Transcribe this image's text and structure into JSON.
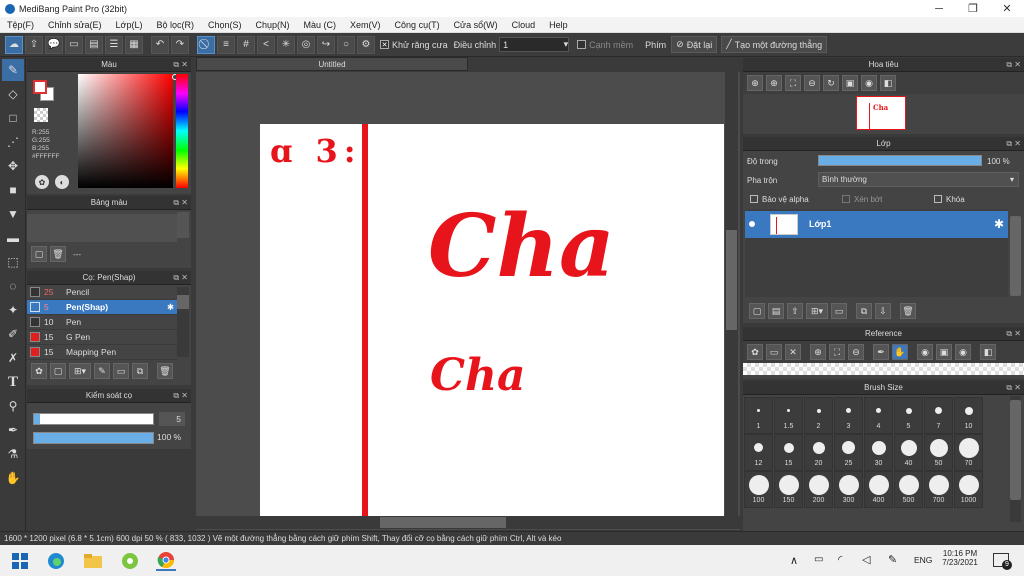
{
  "window": {
    "title": "MediBang Paint Pro (32bit)",
    "minimize": "─",
    "maximize": "❐",
    "close": "✕"
  },
  "menu": [
    "Tệp(F)",
    "Chỉnh sửa(E)",
    "Lớp(L)",
    "Bộ lọc(R)",
    "Chọn(S)",
    "Chụp(N)",
    "Màu (C)",
    "Xem(V)",
    "Công cụ(T)",
    "Cửa sổ(W)",
    "Cloud",
    "Help"
  ],
  "toolbar": {
    "antialias_label": "Khử răng cưa",
    "adjust_label": "Điều chỉnh",
    "adjust_value": "1",
    "edge_label": "Cạnh mềm",
    "key_label": "Phím",
    "reset_label": "Đặt lại",
    "straight_line_label": "Tạo một đường thẳng"
  },
  "color_panel": {
    "title": "Màu",
    "rgb": [
      "R:255",
      "G:255",
      "B:255",
      "#FFFFFF"
    ]
  },
  "palette_panel": {
    "title": "Bảng màu",
    "dash": "---"
  },
  "brush_panel": {
    "title": "Cọ: Pen(Shap)",
    "brushes": [
      {
        "size": "25",
        "name": "Pencil",
        "color": "#333333",
        "active": false
      },
      {
        "size": "5",
        "name": "Pen(Shap)",
        "color": "#3a78c0",
        "active": true
      },
      {
        "size": "10",
        "name": "Pen",
        "color": "#333333",
        "active": false
      },
      {
        "size": "15",
        "name": "G Pen",
        "color": "#e02020",
        "active": false
      },
      {
        "size": "15",
        "name": "Mapping Pen",
        "color": "#e02020",
        "active": false
      }
    ]
  },
  "brush_control": {
    "title": "Kiểm soát cọ",
    "size_value": "5",
    "size_fraction": 0.05,
    "opacity_value": "100 %",
    "opacity_fraction": 1.0
  },
  "canvas": {
    "tab_title": "Untitled",
    "text_top_left": "ɑ 3:",
    "text_large": "Cha",
    "text_small": "Cha"
  },
  "navigator_panel": {
    "title": "Hoa tiêu"
  },
  "layer_panel": {
    "title": "Lớp",
    "opacity_label": "Độ trong",
    "opacity_value": "100 %",
    "opacity_fraction": 1.0,
    "blend_label": "Pha trộn",
    "blend_value": "Bình thường",
    "protect_alpha_label": "Bảo vệ alpha",
    "clip_label": "Xén bớt",
    "lock_label": "Khóa",
    "layer_name": "Lớp1"
  },
  "reference_panel": {
    "title": "Reference"
  },
  "brushsize_panel": {
    "title": "Brush Size",
    "sizes": [
      "1",
      "1.5",
      "2",
      "3",
      "4",
      "5",
      "7",
      "10",
      "12",
      "15",
      "20",
      "25",
      "30",
      "40",
      "50",
      "70",
      "100",
      "150",
      "200",
      "300",
      "400",
      "500",
      "700",
      "1000"
    ]
  },
  "statusbar": {
    "text": "1600 * 1200 pixel  (6.8 * 5.1cm)  600 dpi  50 %  ( 833, 1032 )  Vẽ một đường thẳng bằng cách giữ phím Shift, Thay đổi cỡ cọ bằng cách giữ phím Ctrl, Alt và kéo"
  },
  "taskbar": {
    "lang": "ENG",
    "time": "10:16 PM",
    "date": "7/23/2021",
    "notif_count": "9"
  },
  "colors": {
    "accent": "#3a78c0",
    "ink": "#e8141c"
  }
}
